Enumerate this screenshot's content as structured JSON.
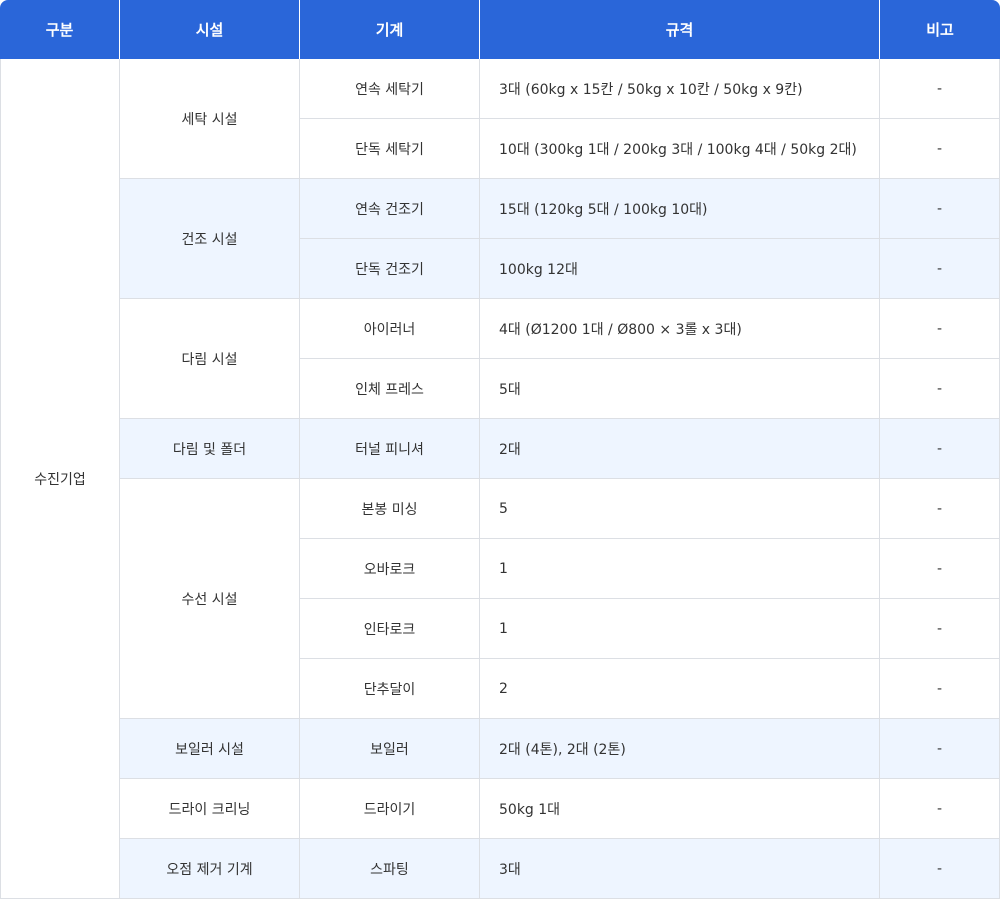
{
  "headers": {
    "category": "구분",
    "facility": "시설",
    "machine": "기계",
    "spec": "규격",
    "note": "비고"
  },
  "category": "수진기업",
  "groups": [
    {
      "facility": "세탁 시설",
      "shaded": false,
      "rows": [
        {
          "machine": "연속 세탁기",
          "spec": "3대 (60kg x 15칸  / 50kg x 10칸 / 50kg x 9칸)",
          "note": "-"
        },
        {
          "machine": "단독 세탁기",
          "spec": "10대 (300kg 1대 / 200kg 3대 / 100kg 4대 / 50kg 2대)",
          "note": "-"
        }
      ]
    },
    {
      "facility": "건조 시설",
      "shaded": true,
      "rows": [
        {
          "machine": "연속 건조기",
          "spec": "15대 (120kg 5대 / 100kg 10대)",
          "note": "-"
        },
        {
          "machine": "단독 건조기",
          "spec": "100kg 12대",
          "note": "-"
        }
      ]
    },
    {
      "facility": "다림 시설",
      "shaded": false,
      "rows": [
        {
          "machine": "아이러너",
          "spec": "4대 (Ø1200 1대 / Ø800 × 3롤 x 3대)",
          "note": "-"
        },
        {
          "machine": "인체 프레스",
          "spec": "5대",
          "note": "-"
        }
      ]
    },
    {
      "facility": "다림 및 폴더",
      "shaded": true,
      "rows": [
        {
          "machine": "터널 피니셔",
          "spec": "2대",
          "note": "-"
        }
      ]
    },
    {
      "facility": "수선 시설",
      "shaded": false,
      "rows": [
        {
          "machine": "본봉 미싱",
          "spec": "5",
          "note": "-"
        },
        {
          "machine": "오바로크",
          "spec": "1",
          "note": "-"
        },
        {
          "machine": "인타로크",
          "spec": "1",
          "note": "-"
        },
        {
          "machine": "단추달이",
          "spec": "2",
          "note": "-"
        }
      ]
    },
    {
      "facility": "보일러 시설",
      "shaded": true,
      "rows": [
        {
          "machine": "보일러",
          "spec": "2대 (4톤), 2대 (2톤)",
          "note": "-"
        }
      ]
    },
    {
      "facility": "드라이 크리닝",
      "shaded": false,
      "rows": [
        {
          "machine": "드라이기",
          "spec": "50kg 1대",
          "note": "-"
        }
      ]
    },
    {
      "facility": "오점 제거 기계",
      "shaded": true,
      "rows": [
        {
          "machine": "스파팅",
          "spec": "3대",
          "note": "-"
        }
      ]
    }
  ]
}
